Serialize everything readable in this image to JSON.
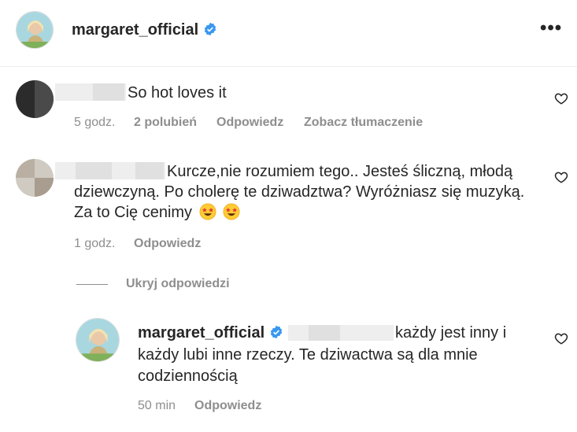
{
  "post_header": {
    "username": "margaret_official",
    "more_label": "•••"
  },
  "comments": [
    {
      "text": "So hot loves it",
      "time": "5 godz.",
      "likes": "2 polubień",
      "reply_label": "Odpowiedz",
      "translate_label": "Zobacz tłumaczenie"
    },
    {
      "text_line1": "Kurcze,nie rozumiem tego.. Jesteś śliczną, młodą",
      "text_line2": "dziewczyną. Po cholerę te dziwadztwa? Wyróżniasz się muzyką.",
      "text_line3": "Za to Cię cenimy",
      "time": "1 godz.",
      "reply_label": "Odpowiedz"
    }
  ],
  "replies_toggle": {
    "label": "Ukryj odpowiedzi"
  },
  "reply": {
    "username": "margaret_official",
    "text_line1": "każdy jest inny i",
    "text_line2": "każdy lubi inne rzeczy. Te dziwactwa są dla mnie",
    "text_line3": "codziennością",
    "time": "50 min",
    "reply_label": "Odpowiedz"
  },
  "icons": {
    "verified": "verified-badge-icon",
    "heart": "heart-outline-icon",
    "emoji": "star-struck-emoji"
  },
  "colors": {
    "verified_blue": "#3897f0",
    "meta_gray": "#8e8e8e",
    "text": "#262626"
  }
}
